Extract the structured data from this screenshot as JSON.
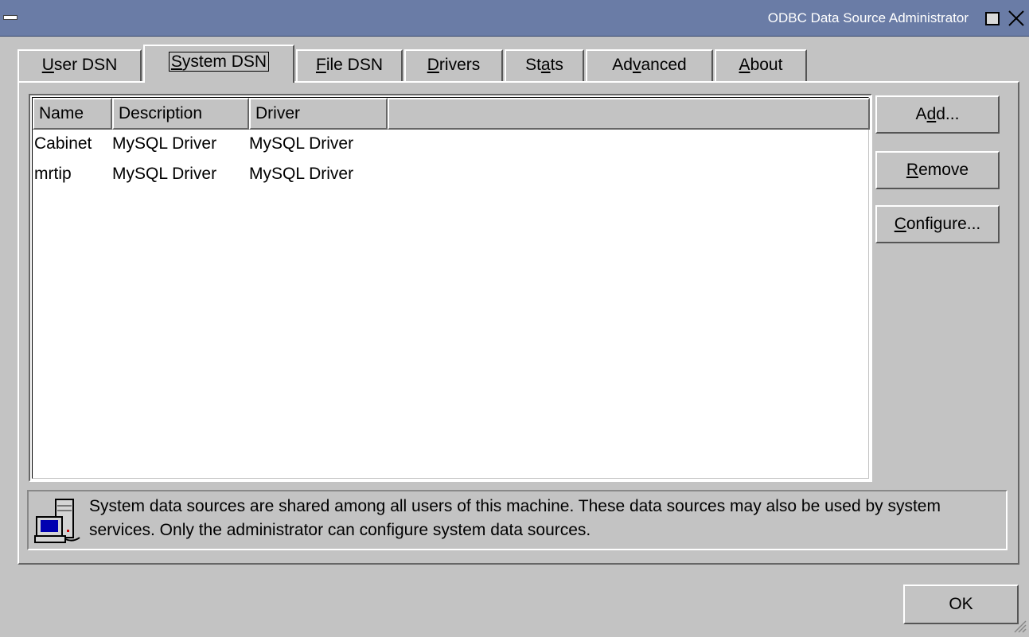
{
  "window": {
    "title": "ODBC Data Source Administrator"
  },
  "tabs": [
    {
      "pre": "",
      "u": "U",
      "post": "ser DSN"
    },
    {
      "pre": "",
      "u": "S",
      "post": "ystem DSN"
    },
    {
      "pre": "",
      "u": "F",
      "post": "ile DSN"
    },
    {
      "pre": "",
      "u": "D",
      "post": "rivers"
    },
    {
      "pre": "St",
      "u": "a",
      "post": "ts"
    },
    {
      "pre": "Ad",
      "u": "v",
      "post": "anced"
    },
    {
      "pre": "",
      "u": "A",
      "post": "bout"
    }
  ],
  "list": {
    "columns": [
      "Name",
      "Description",
      "Driver"
    ],
    "rows": [
      [
        "Cabinet",
        "MySQL Driver",
        "MySQL Driver"
      ],
      [
        "mrtip",
        "MySQL Driver",
        "MySQL Driver"
      ]
    ]
  },
  "buttons": {
    "add": {
      "pre": "A",
      "u": "d",
      "post": "d..."
    },
    "remove": {
      "pre": "",
      "u": "R",
      "post": "emove"
    },
    "configure": {
      "pre": "",
      "u": "C",
      "post": "onfigure..."
    }
  },
  "info": {
    "icon": "computer-icon",
    "text": "System data sources are shared among all users of this machine. These data sources may also be used by system services. Only the administrator can configure system data sources."
  },
  "ok_label": "OK",
  "colors": {
    "titlebar": "#6a7ca6",
    "face": "#c3c3c3"
  }
}
